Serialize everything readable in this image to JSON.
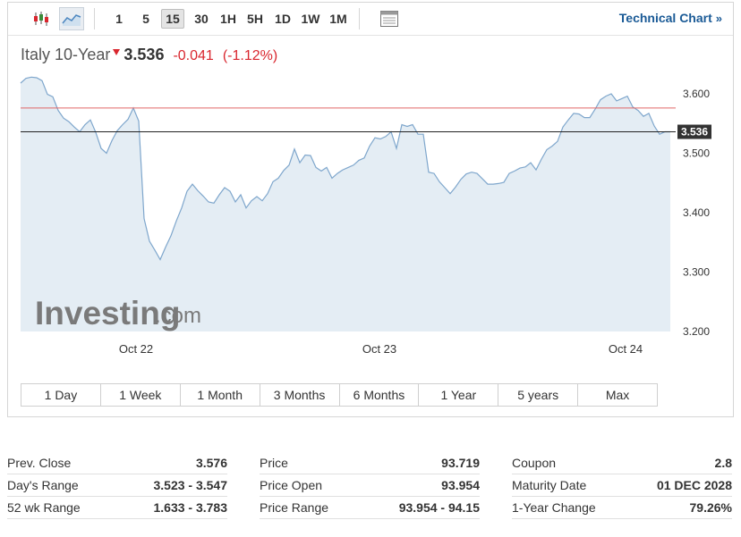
{
  "toolbar": {
    "icons": [
      "candlestick-icon",
      "area-chart-icon",
      "table-icon"
    ],
    "timeframes": [
      "1",
      "5",
      "15",
      "30",
      "1H",
      "5H",
      "1D",
      "1W",
      "1M"
    ],
    "active_timeframe": "15",
    "technical_chart_label": "Technical Chart",
    "technical_chart_chevron": "»"
  },
  "quote": {
    "name": "Italy 10-Year",
    "arrow": "🞃",
    "price": "3.536",
    "change": "-0.041",
    "change_pct": "(-1.12%)"
  },
  "watermark": {
    "brand": "Investing",
    "suffix": ".com"
  },
  "range_buttons": [
    "1 Day",
    "1 Week",
    "1 Month",
    "3 Months",
    "6 Months",
    "1 Year",
    "5 years",
    "Max"
  ],
  "colors": {
    "line": "#7ea6cc",
    "fill": "#e4edf4",
    "prev_close_line": "#e06666",
    "current_line": "#222222",
    "price_label_bg": "#333333",
    "negative": "#d9262e",
    "link": "#1a5a96"
  },
  "chart_data": {
    "type": "area",
    "y_ticks": [
      "3.600",
      "3.500",
      "3.400",
      "3.300",
      "3.200"
    ],
    "ylim": [
      3.2,
      3.63
    ],
    "x_ticks": [
      "Oct 22",
      "Oct 23",
      "Oct 24"
    ],
    "current_value": 3.536,
    "current_label": "3.536",
    "prev_close_value": 3.576,
    "series": [
      {
        "values": [
          3.618,
          3.626,
          3.628,
          3.627,
          3.622,
          3.599,
          3.595,
          3.572,
          3.559,
          3.553,
          3.544,
          3.536,
          3.548,
          3.556,
          3.535,
          3.508,
          3.5,
          3.521,
          3.538,
          3.548,
          3.557,
          3.576,
          3.554,
          3.39,
          3.352,
          3.337,
          3.321,
          3.342,
          3.361,
          3.386,
          3.408,
          3.436,
          3.448,
          3.437,
          3.428,
          3.418,
          3.416,
          3.43,
          3.442,
          3.436,
          3.418,
          3.43,
          3.408,
          3.42,
          3.427,
          3.42,
          3.432,
          3.452,
          3.458,
          3.471,
          3.48,
          3.507,
          3.484,
          3.497,
          3.496,
          3.476,
          3.47,
          3.476,
          3.458,
          3.466,
          3.472,
          3.476,
          3.48,
          3.488,
          3.492,
          3.512,
          3.526,
          3.524,
          3.528,
          3.536,
          3.508,
          3.548,
          3.545,
          3.548,
          3.532,
          3.532,
          3.468,
          3.466,
          3.452,
          3.442,
          3.432,
          3.443,
          3.456,
          3.465,
          3.468,
          3.466,
          3.457,
          3.448,
          3.448,
          3.449,
          3.451,
          3.466,
          3.47,
          3.475,
          3.477,
          3.484,
          3.472,
          3.49,
          3.506,
          3.512,
          3.52,
          3.544,
          3.556,
          3.567,
          3.566,
          3.56,
          3.56,
          3.574,
          3.59,
          3.596,
          3.6,
          3.588,
          3.592,
          3.596,
          3.578,
          3.572,
          3.562,
          3.567,
          3.546,
          3.532,
          3.536,
          3.536
        ]
      }
    ]
  },
  "stats": [
    [
      {
        "k": "Prev. Close",
        "v": "3.576"
      },
      {
        "k": "Day's Range",
        "v": "3.523 - 3.547"
      },
      {
        "k": "52 wk Range",
        "v": "1.633 - 3.783"
      }
    ],
    [
      {
        "k": "Price",
        "v": "93.719"
      },
      {
        "k": "Price Open",
        "v": "93.954"
      },
      {
        "k": "Price Range",
        "v": "93.954 - 94.15"
      }
    ],
    [
      {
        "k": "Coupon",
        "v": "2.8"
      },
      {
        "k": "Maturity Date",
        "v": "01 DEC 2028"
      },
      {
        "k": "1-Year Change",
        "v": "79.26%"
      }
    ]
  ]
}
